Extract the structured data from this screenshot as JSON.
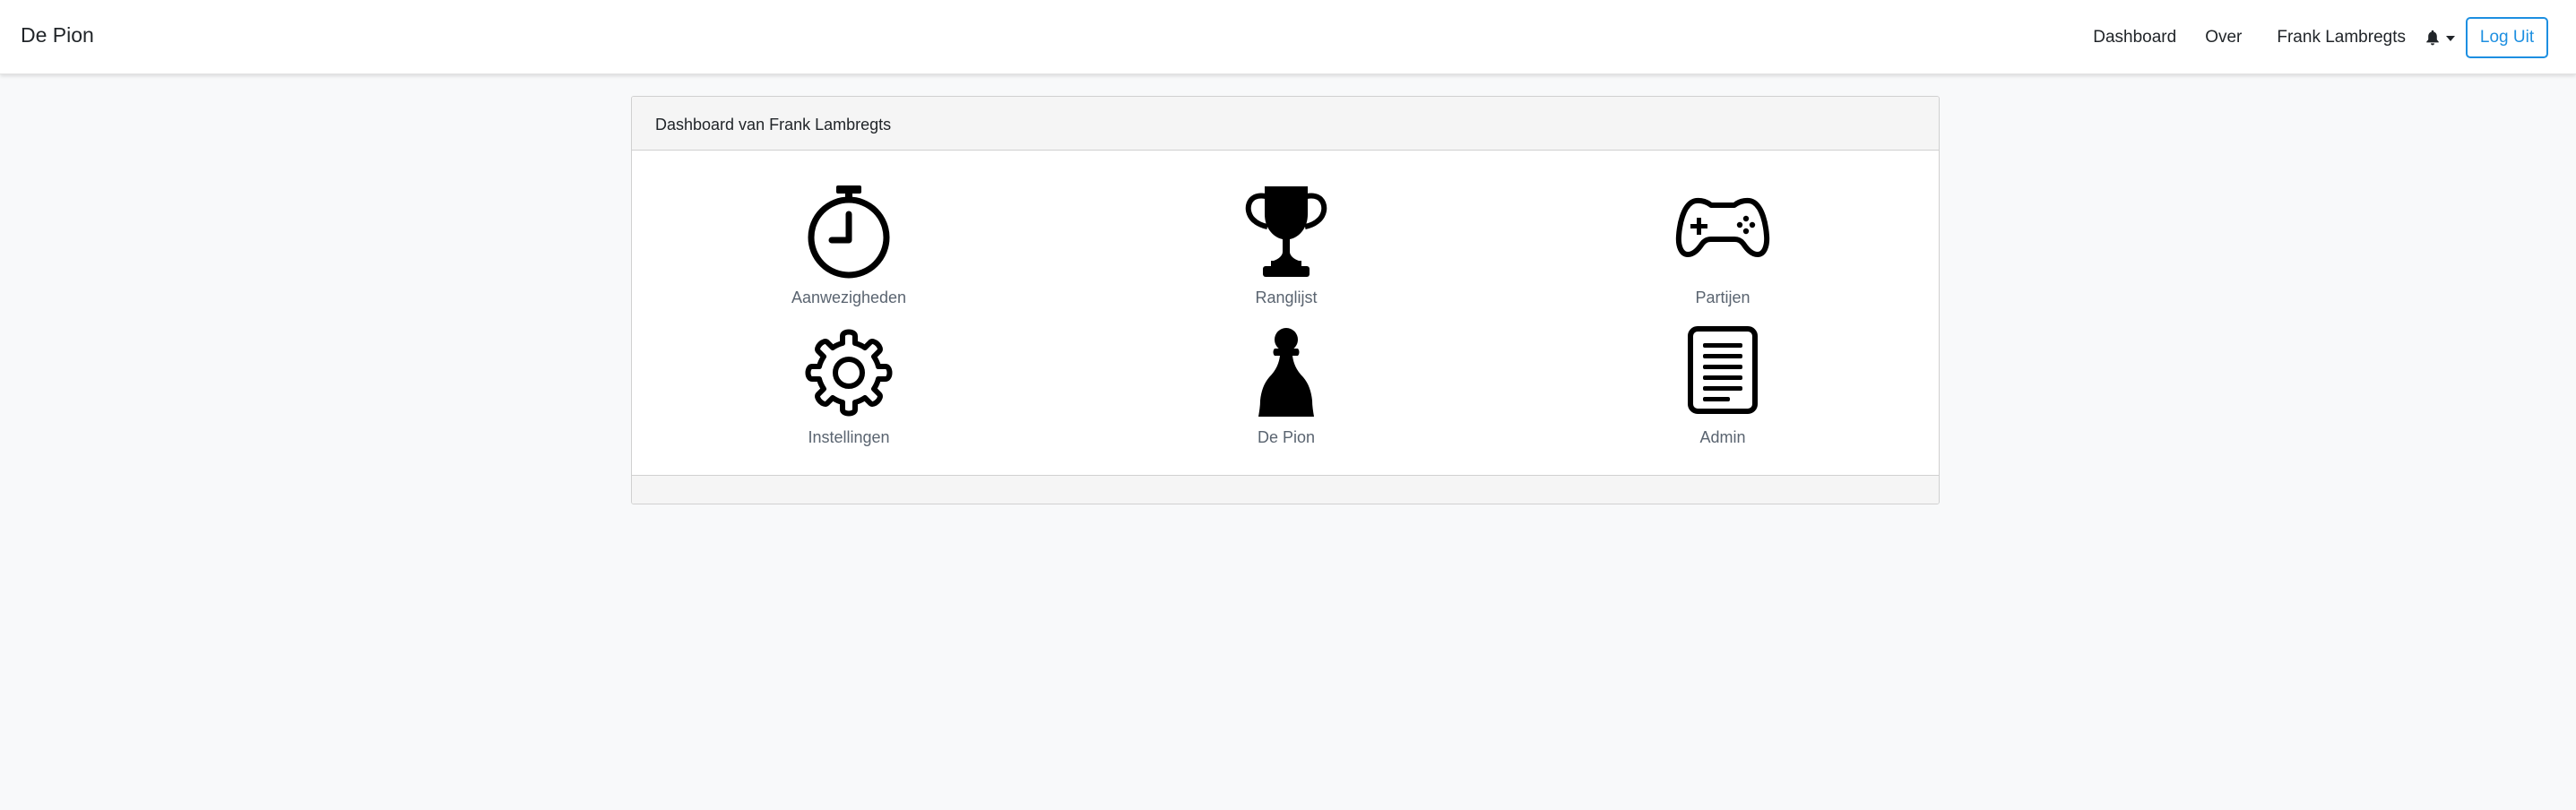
{
  "navbar": {
    "brand": "De Pion",
    "links": {
      "dashboard": "Dashboard",
      "over": "Over",
      "user": "Frank Lambregts"
    },
    "logout": "Log Uit"
  },
  "card": {
    "title": "Dashboard van Frank Lambregts",
    "tiles": [
      {
        "label": "Aanwezigheden",
        "icon": "stopwatch-icon"
      },
      {
        "label": "Ranglijst",
        "icon": "trophy-icon"
      },
      {
        "label": "Partijen",
        "icon": "gamepad-icon"
      },
      {
        "label": "Instellingen",
        "icon": "gear-icon"
      },
      {
        "label": "De Pion",
        "icon": "chess-pawn-icon"
      },
      {
        "label": "Admin",
        "icon": "document-icon"
      }
    ]
  },
  "colors": {
    "accent": "#1d8fe1",
    "background": "#f8f9fa",
    "tile_label": "#5a6470"
  }
}
